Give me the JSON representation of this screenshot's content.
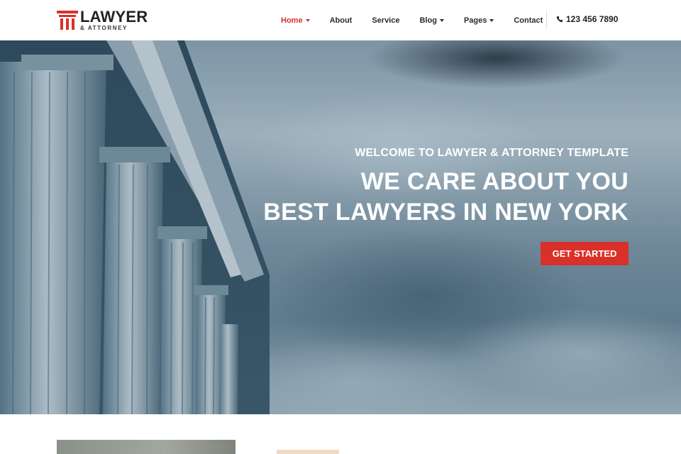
{
  "brand": {
    "title": "LAWYER",
    "subtitle": "& ATTORNEY",
    "accent_color": "#d9302a"
  },
  "nav": {
    "items": [
      {
        "label": "Home",
        "has_dropdown": true,
        "active": true
      },
      {
        "label": "About",
        "has_dropdown": false,
        "active": false
      },
      {
        "label": "Service",
        "has_dropdown": false,
        "active": false
      },
      {
        "label": "Blog",
        "has_dropdown": true,
        "active": false
      },
      {
        "label": "Pages",
        "has_dropdown": true,
        "active": false
      },
      {
        "label": "Contact",
        "has_dropdown": false,
        "active": false
      }
    ],
    "phone": "123 456 7890",
    "phone_icon": "phone-icon"
  },
  "hero": {
    "kicker": "WELCOME TO LAWYER & ATTORNEY TEMPLATE",
    "line1": "WE CARE ABOUT YOU",
    "line2": "BEST LAWYERS IN NEW YORK",
    "cta_label": "GET STARTED"
  }
}
